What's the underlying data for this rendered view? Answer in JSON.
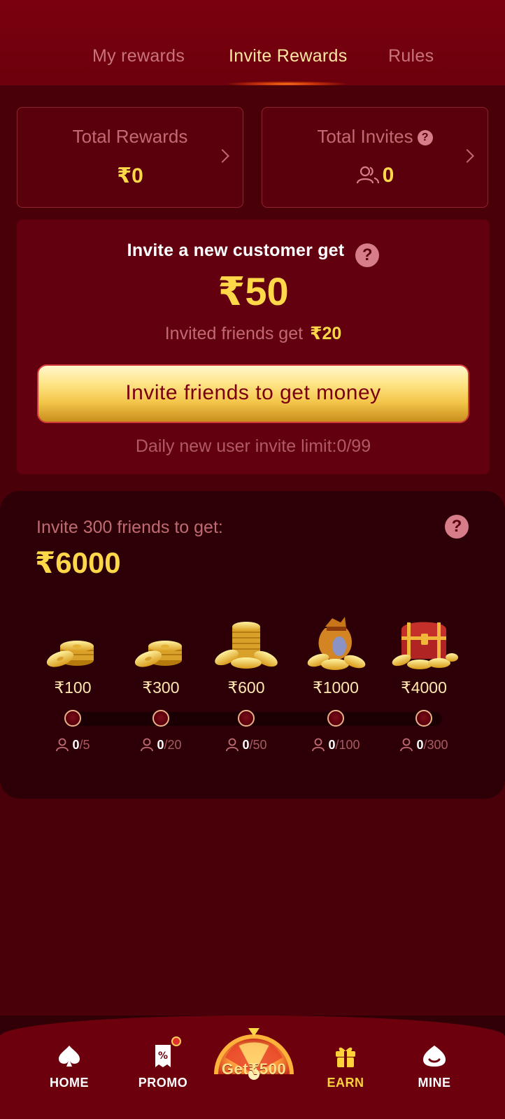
{
  "tabs": [
    {
      "label": "My rewards",
      "active": false
    },
    {
      "label": "Invite Rewards",
      "active": true
    },
    {
      "label": "Rules",
      "active": false
    }
  ],
  "stats": {
    "total_rewards": {
      "label": "Total Rewards",
      "value": "₹0"
    },
    "total_invites": {
      "label": "Total Invites",
      "value": "0"
    }
  },
  "invite": {
    "title": "Invite a new customer get",
    "amount": "₹50",
    "friends_label": "Invited friends get",
    "friends_amount": "₹20",
    "button_label": "Invite friends to get money",
    "limit_text": "Daily new user invite limit:0/99"
  },
  "milestones": {
    "title": "Invite 300 friends to get:",
    "amount": "₹6000",
    "items": [
      {
        "reward": "₹100",
        "current": "0",
        "target": "/5",
        "icon": "coin-stack-icon"
      },
      {
        "reward": "₹300",
        "current": "0",
        "target": "/20",
        "icon": "coin-stack-icon"
      },
      {
        "reward": "₹600",
        "current": "0",
        "target": "/50",
        "icon": "coin-pile-icon"
      },
      {
        "reward": "₹1000",
        "current": "0",
        "target": "/100",
        "icon": "money-bag-icon"
      },
      {
        "reward": "₹4000",
        "current": "0",
        "target": "/300",
        "icon": "treasure-chest-icon"
      }
    ]
  },
  "bottom_nav": {
    "home": "HOME",
    "promo": "PROMO",
    "wheel": "Get₹500",
    "earn": "EARN",
    "mine": "MINE",
    "active": "EARN"
  },
  "colors": {
    "header_bg": "#7a000f",
    "page_bg": "#4a0008",
    "accent_gold": "#ffd84a",
    "muted_text": "#c06a72"
  }
}
